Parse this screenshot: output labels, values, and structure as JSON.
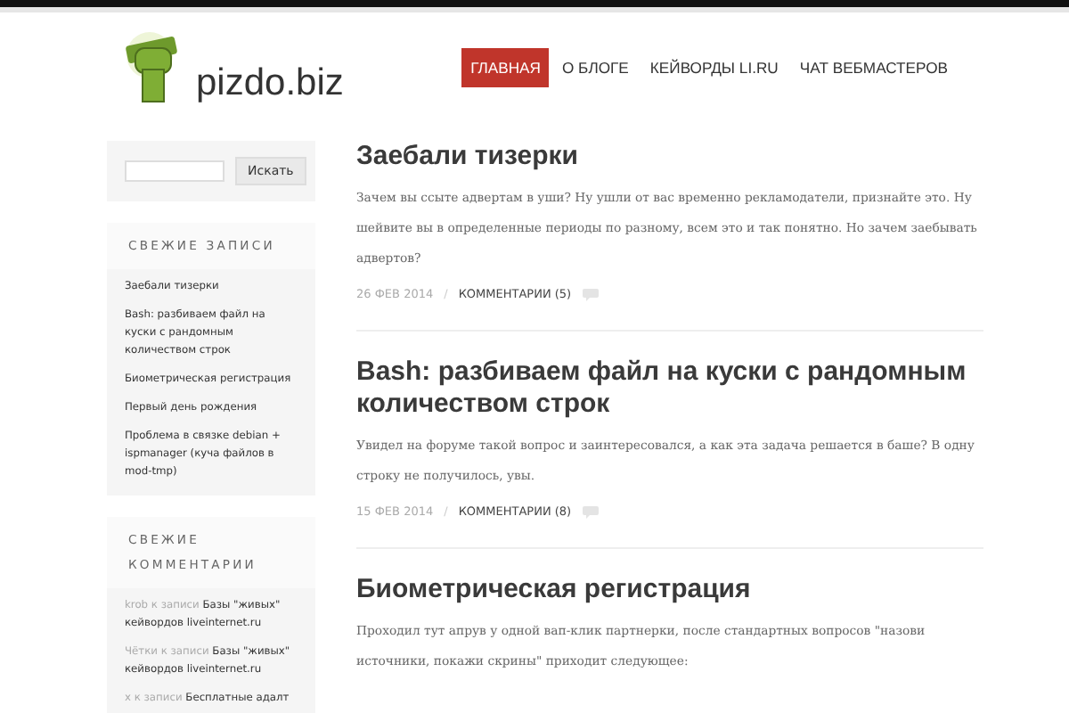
{
  "logo": {
    "text": "pizdo.biz"
  },
  "nav": [
    {
      "label": "ГЛАВНАЯ",
      "selected": true
    },
    {
      "label": "О БЛОГЕ",
      "selected": false
    },
    {
      "label": "КЕЙВОРДЫ LI.RU",
      "selected": false
    },
    {
      "label": "ЧАТ ВЕБМАСТЕРОВ",
      "selected": false
    }
  ],
  "sidebar": {
    "search": {
      "button": "Искать"
    },
    "recent_posts": {
      "title": "СВЕЖИЕ ЗАПИСИ",
      "items": [
        "Заебали тизерки",
        "Bash: разбиваем файл на куски с рандомным количеством строк",
        "Биометрическая регистрация",
        "Первый день рождения",
        "Проблема в связке debian + ispmanager (куча файлов в mod-tmp)"
      ]
    },
    "recent_comments": {
      "title": "СВЕЖИЕ КОММЕНТАРИИ",
      "items": [
        {
          "author": "krob",
          "connector": "к записи",
          "post": "Базы \"живых\" кейвордов liveinternet.ru"
        },
        {
          "author": "Чётки",
          "connector": "к записи",
          "post": "Базы \"живых\" кейвордов liveinternet.ru"
        },
        {
          "author": "x",
          "connector": "к записи",
          "post": "Бесплатные адалт"
        }
      ]
    }
  },
  "posts": [
    {
      "title": "Заебали тизерки",
      "excerpt": "Зачем вы ссыте адвертам в уши? Ну ушли от вас временно рекламодатели, признайте это. Ну шейвите вы в определенные периоды по разному, всем это и так понятно. Но зачем заебывать адвертов?",
      "date": "26 ФЕВ 2014",
      "separator": "/",
      "comments": "КОММЕНТАРИИ (5)"
    },
    {
      "title": "Bash: разбиваем файл на куски с рандомным количеством строк",
      "excerpt": "Увидел на форуме такой вопрос и заинтересовался, а как эта задача решается в баше? В одну строку не получилось, увы.",
      "date": "15 ФЕВ 2014",
      "separator": "/",
      "comments": "КОММЕНТАРИИ (8)"
    },
    {
      "title": "Биометрическая регистрация",
      "excerpt": "Проходил тут апрув у одной вап-клик партнерки, после стандартных вопросов \"назови источники, покажи скрины\" приходит следующее:"
    }
  ]
}
